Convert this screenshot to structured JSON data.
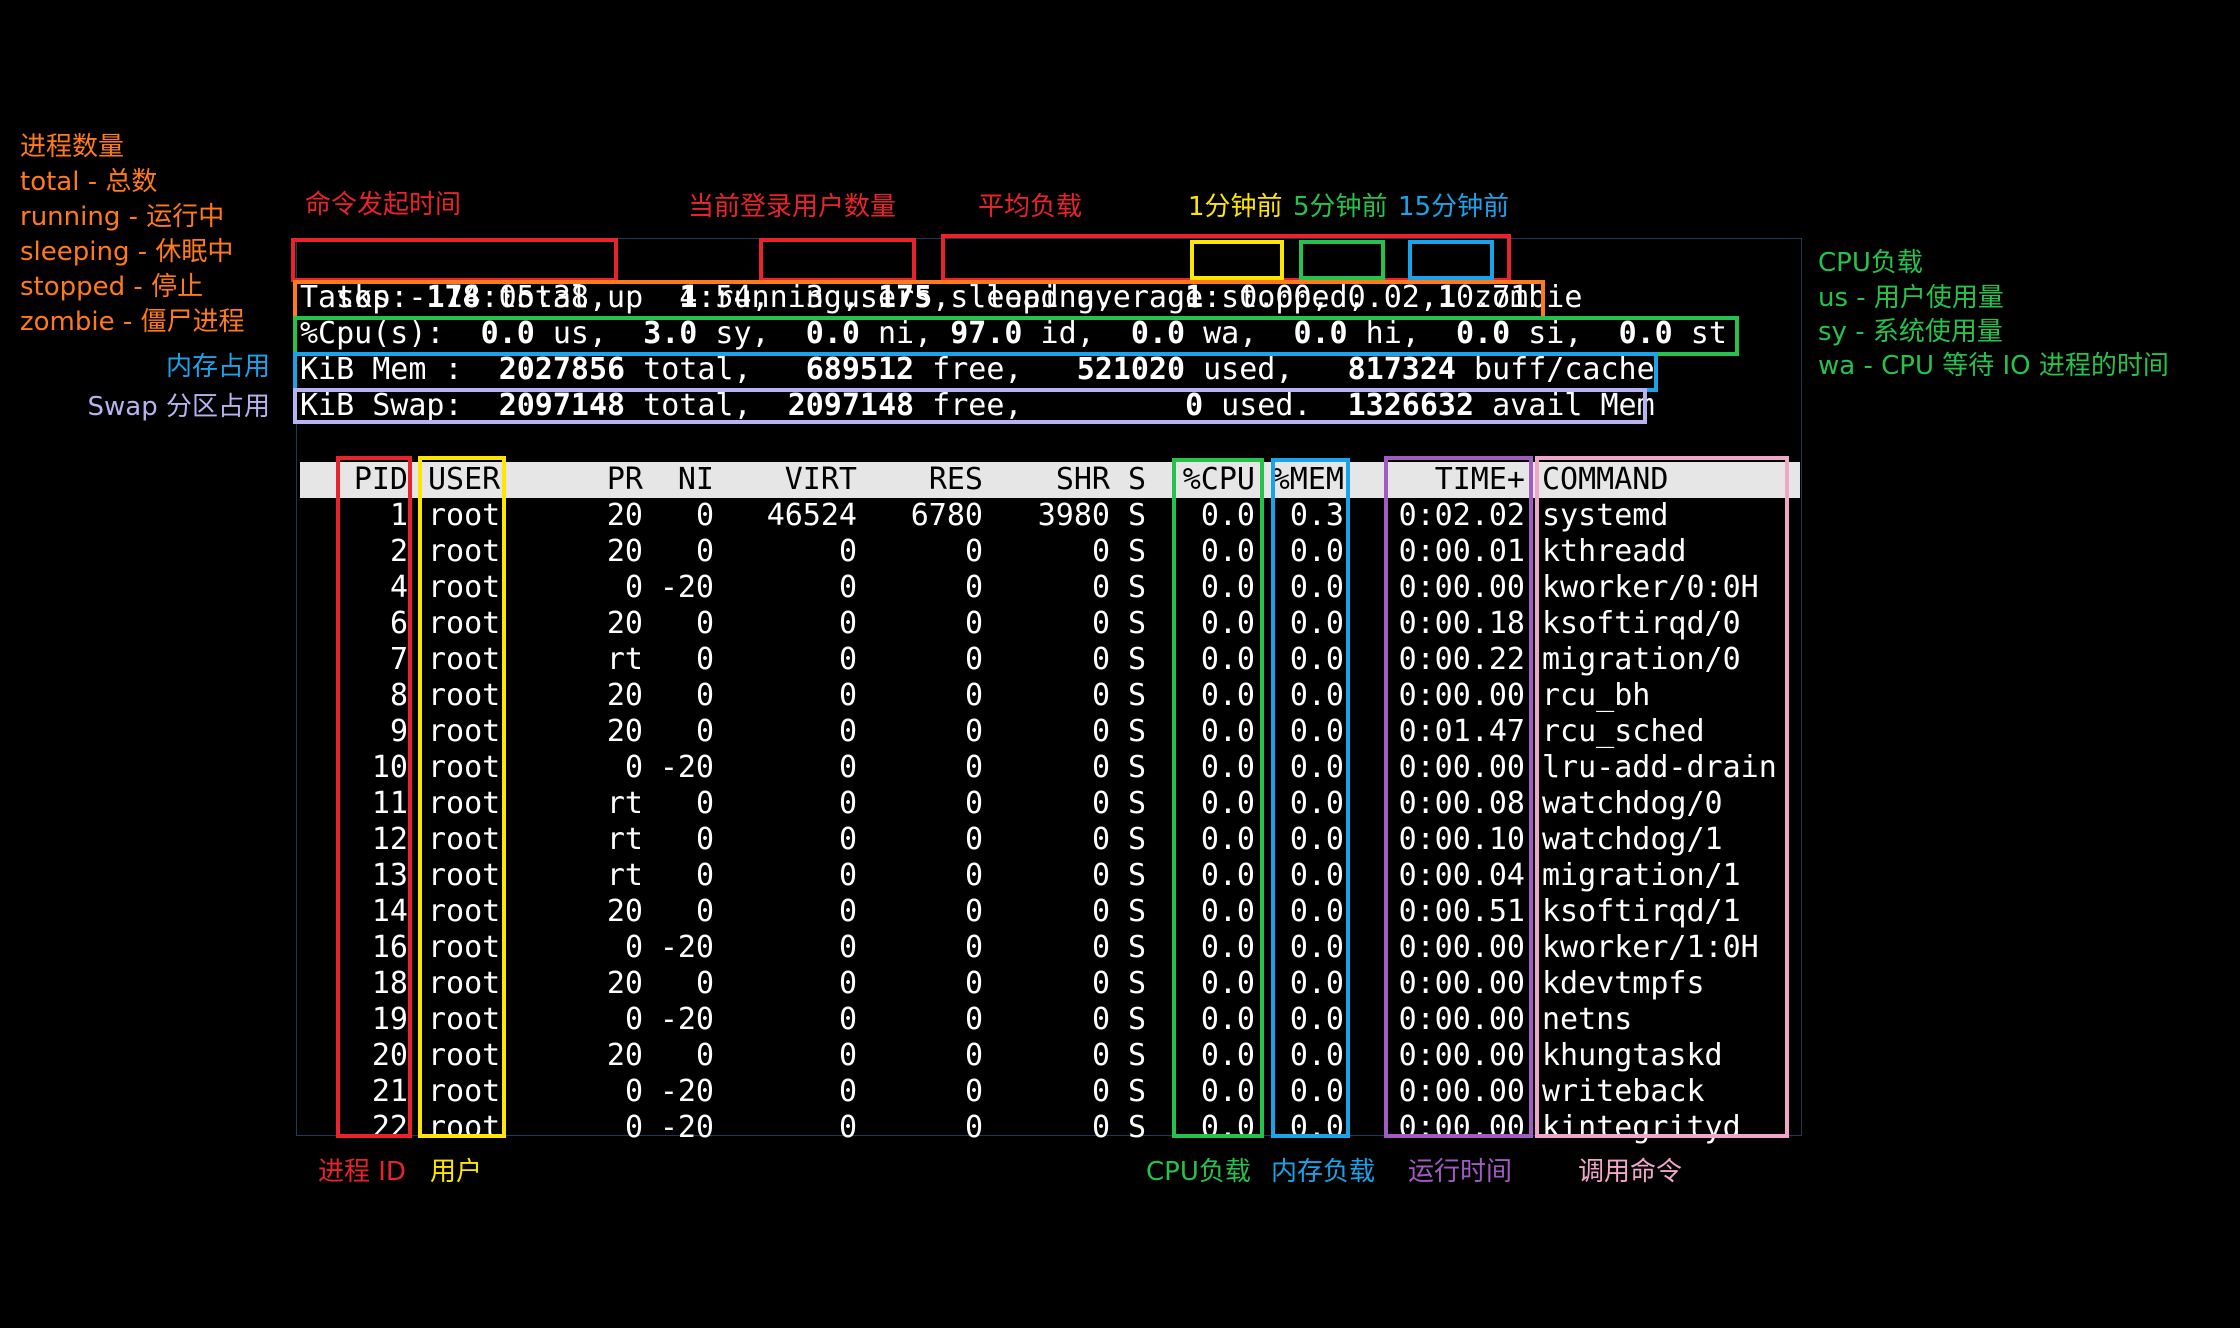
{
  "colors": {
    "red": "#e8232b",
    "orange": "#ff7a1a",
    "yellow": "#ffe600",
    "green": "#27c24c",
    "blue": "#1aa3e8",
    "lavender": "#b7b3f0",
    "purple": "#a35bc4",
    "pink": "#f0a6c8",
    "white": "#ffffff",
    "header_bg": "#e6e6e6"
  },
  "annotations": {
    "proc_title": "进程数量",
    "proc_total": "total - 总数",
    "proc_running": "running - 运行中",
    "proc_sleeping": "sleeping - 休眠中",
    "proc_stopped": "stopped - 停止",
    "proc_zombie": "zombie - 僵尸进程",
    "mem": "内存占用",
    "swap": "Swap 分区占用",
    "cmd_time": "命令发起时间",
    "users_count": "当前登录用户数量",
    "load_avg": "平均负载",
    "m1": "1分钟前",
    "m5": "5分钟前",
    "m15": "15分钟前",
    "cpu_title": "CPU负载",
    "cpu_us": "us - 用户使用量",
    "cpu_sy": "sy - 系统使用量",
    "cpu_wa": "wa - CPU 等待 IO 进程的时间",
    "pid": "进程 ID",
    "user": "用户",
    "cpu_load": "CPU负载",
    "mem_load": "内存负载",
    "run_time": "运行时间",
    "command": "调用命令"
  },
  "summary": {
    "l1_a": "top - 14:05:38 up",
    "l1_b": "  4:54,  ",
    "l1_c": "3 users,",
    "l1_d": "  load average: ",
    "l1_e": "0.00",
    "l1_f": ", ",
    "l1_g": "0.02",
    "l1_h": ", ",
    "l1_i": "0.71",
    "tasks": [
      {
        "t": "Tasks: ",
        "b": false
      },
      {
        "t": "178",
        "b": true
      },
      {
        "t": " total,    ",
        "b": false
      },
      {
        "t": "1",
        "b": true
      },
      {
        "t": " running, ",
        "b": false
      },
      {
        "t": "175",
        "b": true
      },
      {
        "t": " sleeping,    ",
        "b": false
      },
      {
        "t": "1",
        "b": true
      },
      {
        "t": " stopped,    ",
        "b": false
      },
      {
        "t": "1",
        "b": true
      },
      {
        "t": " zombie",
        "b": false
      }
    ],
    "cpu": [
      {
        "t": "%Cpu(s):  ",
        "b": false
      },
      {
        "t": "0.0",
        "b": true
      },
      {
        "t": " us,  ",
        "b": false
      },
      {
        "t": "3.0",
        "b": true
      },
      {
        "t": " sy,  ",
        "b": false
      },
      {
        "t": "0.0",
        "b": true
      },
      {
        "t": " ni, ",
        "b": false
      },
      {
        "t": "97.0",
        "b": true
      },
      {
        "t": " id,  ",
        "b": false
      },
      {
        "t": "0.0",
        "b": true
      },
      {
        "t": " wa,  ",
        "b": false
      },
      {
        "t": "0.0",
        "b": true
      },
      {
        "t": " hi,  ",
        "b": false
      },
      {
        "t": "0.0",
        "b": true
      },
      {
        "t": " si,  ",
        "b": false
      },
      {
        "t": "0.0",
        "b": true
      },
      {
        "t": " st",
        "b": false
      }
    ],
    "mem": [
      {
        "t": "KiB Mem :  ",
        "b": false
      },
      {
        "t": "2027856",
        "b": true
      },
      {
        "t": " total,   ",
        "b": false
      },
      {
        "t": "689512",
        "b": true
      },
      {
        "t": " free,   ",
        "b": false
      },
      {
        "t": "521020",
        "b": true
      },
      {
        "t": " used,   ",
        "b": false
      },
      {
        "t": "817324",
        "b": true
      },
      {
        "t": " buff/cache",
        "b": false
      }
    ],
    "swap": [
      {
        "t": "KiB Swap:  ",
        "b": false
      },
      {
        "t": "2097148",
        "b": true
      },
      {
        "t": " total,  ",
        "b": false
      },
      {
        "t": "2097148",
        "b": true
      },
      {
        "t": " free,         ",
        "b": false
      },
      {
        "t": "0",
        "b": true
      },
      {
        "t": " used.  ",
        "b": false
      },
      {
        "t": "1326632",
        "b": true
      },
      {
        "t": " avail Mem",
        "b": false
      }
    ]
  },
  "columns": [
    "PID",
    "USER",
    "PR",
    "NI",
    "VIRT",
    "RES",
    "SHR",
    "S",
    "%CPU",
    "%MEM",
    "TIME+",
    "COMMAND"
  ],
  "processes": [
    [
      "1",
      "root",
      "20",
      "0",
      "46524",
      "6780",
      "3980",
      "S",
      "0.0",
      "0.3",
      "0:02.02",
      "systemd"
    ],
    [
      "2",
      "root",
      "20",
      "0",
      "0",
      "0",
      "0",
      "S",
      "0.0",
      "0.0",
      "0:00.01",
      "kthreadd"
    ],
    [
      "4",
      "root",
      "0",
      "-20",
      "0",
      "0",
      "0",
      "S",
      "0.0",
      "0.0",
      "0:00.00",
      "kworker/0:0H"
    ],
    [
      "6",
      "root",
      "20",
      "0",
      "0",
      "0",
      "0",
      "S",
      "0.0",
      "0.0",
      "0:00.18",
      "ksoftirqd/0"
    ],
    [
      "7",
      "root",
      "rt",
      "0",
      "0",
      "0",
      "0",
      "S",
      "0.0",
      "0.0",
      "0:00.22",
      "migration/0"
    ],
    [
      "8",
      "root",
      "20",
      "0",
      "0",
      "0",
      "0",
      "S",
      "0.0",
      "0.0",
      "0:00.00",
      "rcu_bh"
    ],
    [
      "9",
      "root",
      "20",
      "0",
      "0",
      "0",
      "0",
      "S",
      "0.0",
      "0.0",
      "0:01.47",
      "rcu_sched"
    ],
    [
      "10",
      "root",
      "0",
      "-20",
      "0",
      "0",
      "0",
      "S",
      "0.0",
      "0.0",
      "0:00.00",
      "lru-add-drain"
    ],
    [
      "11",
      "root",
      "rt",
      "0",
      "0",
      "0",
      "0",
      "S",
      "0.0",
      "0.0",
      "0:00.08",
      "watchdog/0"
    ],
    [
      "12",
      "root",
      "rt",
      "0",
      "0",
      "0",
      "0",
      "S",
      "0.0",
      "0.0",
      "0:00.10",
      "watchdog/1"
    ],
    [
      "13",
      "root",
      "rt",
      "0",
      "0",
      "0",
      "0",
      "S",
      "0.0",
      "0.0",
      "0:00.04",
      "migration/1"
    ],
    [
      "14",
      "root",
      "20",
      "0",
      "0",
      "0",
      "0",
      "S",
      "0.0",
      "0.0",
      "0:00.51",
      "ksoftirqd/1"
    ],
    [
      "16",
      "root",
      "0",
      "-20",
      "0",
      "0",
      "0",
      "S",
      "0.0",
      "0.0",
      "0:00.00",
      "kworker/1:0H"
    ],
    [
      "18",
      "root",
      "20",
      "0",
      "0",
      "0",
      "0",
      "S",
      "0.0",
      "0.0",
      "0:00.00",
      "kdevtmpfs"
    ],
    [
      "19",
      "root",
      "0",
      "-20",
      "0",
      "0",
      "0",
      "S",
      "0.0",
      "0.0",
      "0:00.00",
      "netns"
    ],
    [
      "20",
      "root",
      "20",
      "0",
      "0",
      "0",
      "0",
      "S",
      "0.0",
      "0.0",
      "0:00.00",
      "khungtaskd"
    ],
    [
      "21",
      "root",
      "0",
      "-20",
      "0",
      "0",
      "0",
      "S",
      "0.0",
      "0.0",
      "0:00.00",
      "writeback"
    ],
    [
      "22",
      "root",
      "0",
      "-20",
      "0",
      "0",
      "0",
      "S",
      "0.0",
      "0.0",
      "0:00.00",
      "kintegrityd"
    ]
  ]
}
